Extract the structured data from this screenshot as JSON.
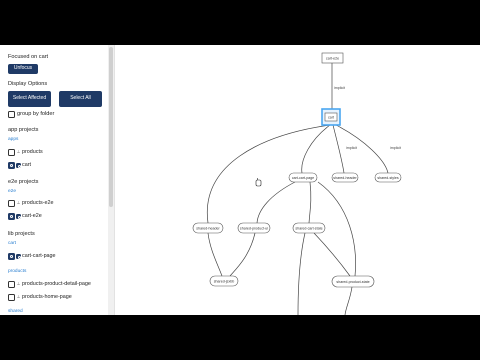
{
  "sidebar": {
    "focused_label": "Focused on cart",
    "unfocus_label": "Unfocus",
    "display_options_label": "Display Options",
    "select_affected_label": "Select Affected",
    "select_all_label": "Select All",
    "group_by_folder_label": "group by folder",
    "sections": [
      {
        "title": "app projects",
        "groups": [
          {
            "name": "apps",
            "items": [
              "products",
              "cart"
            ]
          }
        ]
      },
      {
        "title": "e2e projects",
        "groups": [
          {
            "name": "e2e",
            "items": [
              "products-e2e",
              "cart-e2e"
            ]
          }
        ]
      },
      {
        "title": "lib projects",
        "groups": [
          {
            "name": "cart",
            "items": [
              "cart-cart-page"
            ]
          },
          {
            "name": "products",
            "items": [
              "products-product-detail-page",
              "products-home-page"
            ]
          },
          {
            "name": "shared",
            "items": []
          }
        ]
      }
    ]
  },
  "graph": {
    "nodes": {
      "cart_e2e": "cart-e2e",
      "cart": "cart",
      "cart_cart_page": "cart-cart-page",
      "shared_header": "shared-header",
      "shared_styles": "shared-styles",
      "shared_product_ui": "shared-product-ui",
      "shared_cart_state": "shared-cart-state",
      "shared_jsxbb": "shared-jsxbb",
      "shared_product_state": "shared-product-state"
    },
    "edge_labels": {
      "implicit": "implicit"
    }
  }
}
